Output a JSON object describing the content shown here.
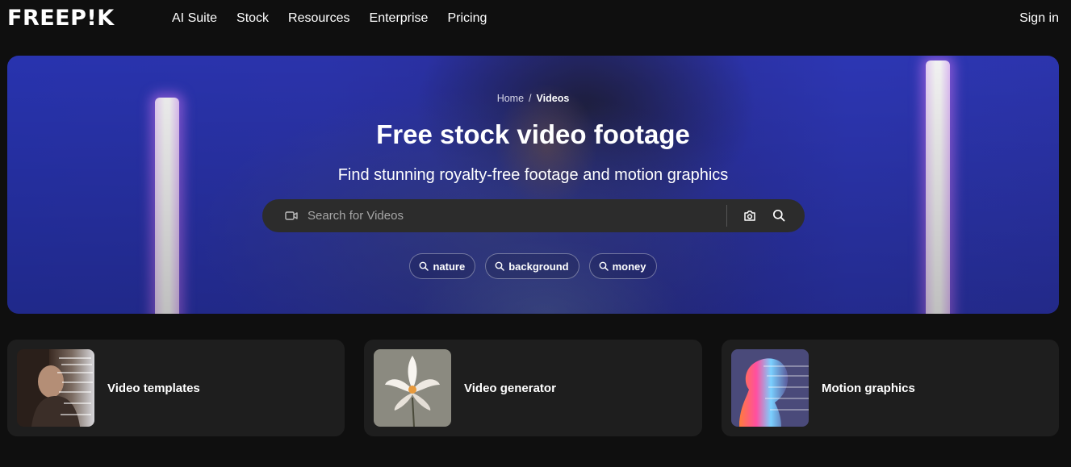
{
  "header": {
    "logo": "FREEP!K",
    "nav": [
      "AI Suite",
      "Stock",
      "Resources",
      "Enterprise",
      "Pricing"
    ],
    "sign_in": "Sign in"
  },
  "hero": {
    "breadcrumb": {
      "home": "Home",
      "separator": "/",
      "current": "Videos"
    },
    "title": "Free stock video footage",
    "subtitle": "Find stunning royalty-free footage and motion graphics",
    "search": {
      "placeholder": "Search for Videos",
      "value": ""
    },
    "chips": [
      "nature",
      "background",
      "money"
    ]
  },
  "cards": [
    {
      "label": "Video templates"
    },
    {
      "label": "Video generator"
    },
    {
      "label": "Motion graphics"
    }
  ],
  "colors": {
    "page_bg": "#0f0f0f",
    "card_bg": "#1e1e1e",
    "search_bg": "#2c2c2c",
    "hero_blue": "#2d36b4"
  },
  "icons": [
    "video-camera-icon",
    "camera-icon",
    "search-icon"
  ]
}
